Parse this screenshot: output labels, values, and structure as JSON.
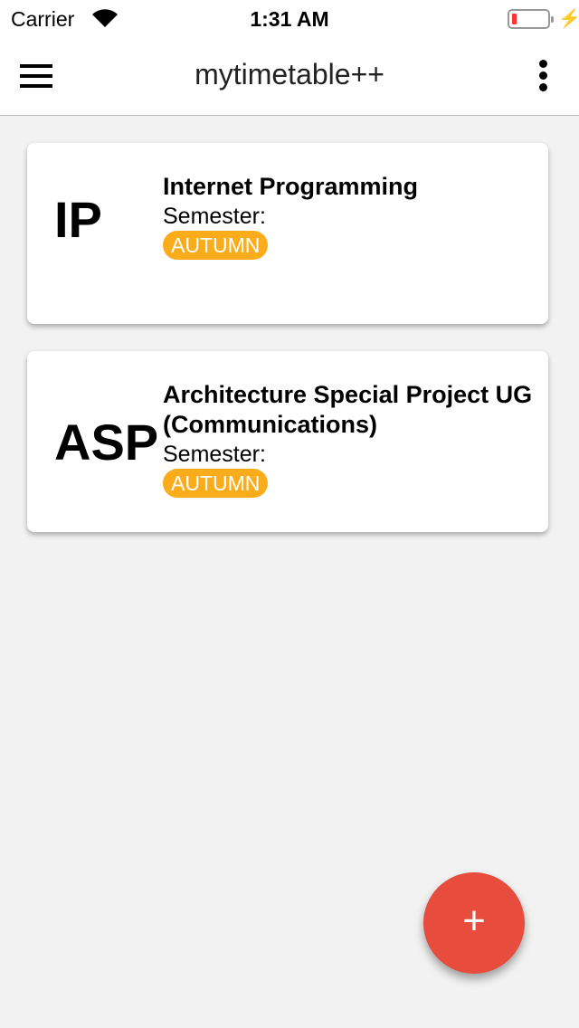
{
  "status": {
    "carrier": "Carrier",
    "time": "1:31 AM",
    "battery_percent": 10
  },
  "header": {
    "title": "mytimetable++"
  },
  "subjects": [
    {
      "abbr": "IP",
      "name": "Internet Programming",
      "semester_label": "Semester:",
      "semester": "AUTUMN"
    },
    {
      "abbr": "ASP",
      "name": "Architecture Special Project UG (Communications)",
      "semester_label": "Semester:",
      "semester": "AUTUMN"
    }
  ],
  "fab": {
    "label": "+"
  },
  "colors": {
    "badge": "#fbac1b",
    "fab": "#e74c3c"
  }
}
